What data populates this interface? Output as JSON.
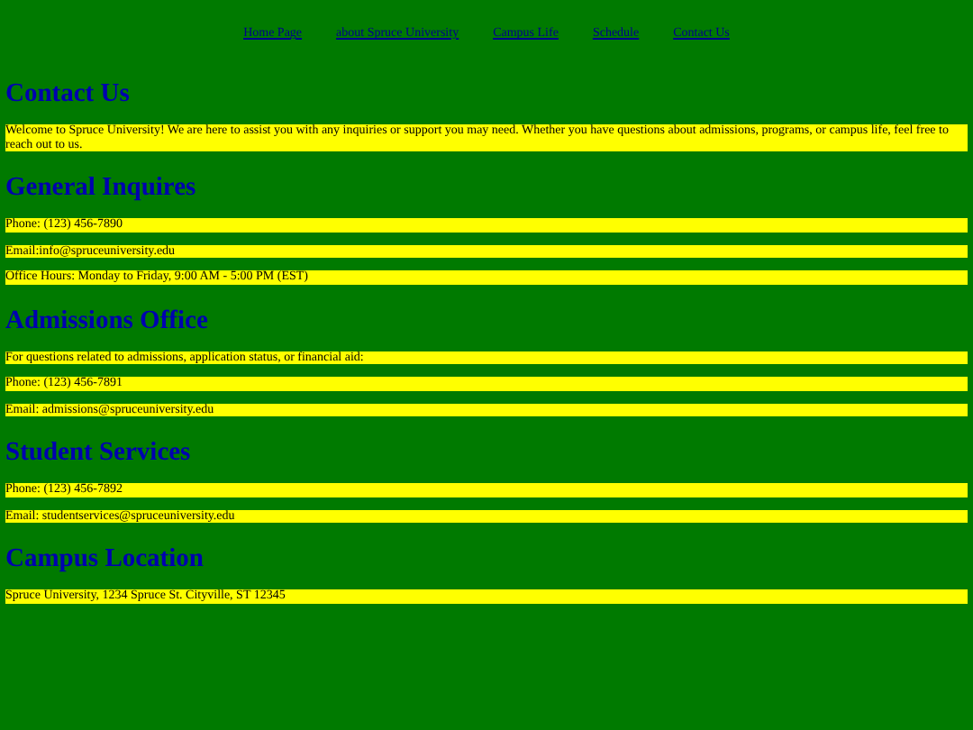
{
  "nav": [
    {
      "label": "Home Page"
    },
    {
      "label": "about Spruce University"
    },
    {
      "label": "Campus Life"
    },
    {
      "label": "Schedule"
    },
    {
      "label": "Contact Us"
    }
  ],
  "title": "Contact Us",
  "intro": "Welcome to Spruce University! We are here to assist you with any inquiries or support you may need. Whether you have questions about admissions, programs, or campus life, feel free to reach out to us.",
  "sections": [
    {
      "heading": "General Inquires",
      "lines": [
        "Phone: (123) 456-7890",
        "Email:info@spruceuniversity.edu",
        "Office Hours: Monday to Friday, 9:00 AM - 5:00 PM (EST)"
      ]
    },
    {
      "heading": "Admissions Office",
      "lines": [
        "For questions related to admissions, application status, or financial aid:",
        "Phone: (123) 456-7891",
        "Email: admissions@spruceuniversity.edu"
      ]
    },
    {
      "heading": "Student Services",
      "lines": [
        "Phone: (123) 456-7892",
        "Email: studentservices@spruceuniversity.edu"
      ]
    },
    {
      "heading": "Campus Location",
      "lines": [
        "Spruce University, 1234 Spruce St. Cityville, ST 12345"
      ]
    }
  ]
}
